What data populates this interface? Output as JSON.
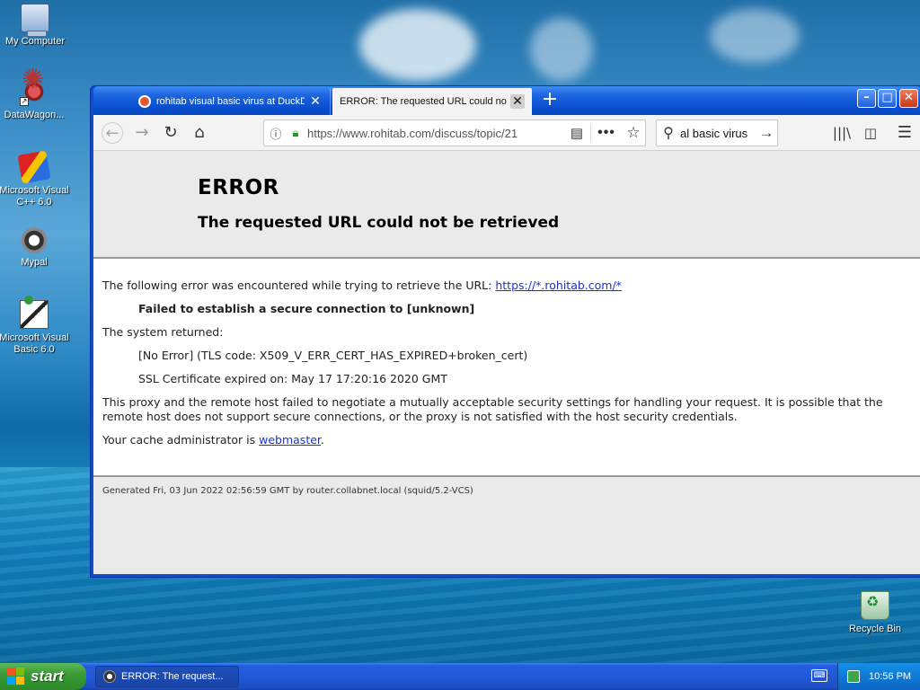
{
  "desktop": {
    "icons": [
      {
        "label": "My Computer",
        "icon": "computer-icon"
      },
      {
        "label": "DataWagon...",
        "icon": "datawagon-icon"
      },
      {
        "label": "Microsoft Visual C++ 6.0",
        "icon": "visual-cpp-icon"
      },
      {
        "label": "Mypal",
        "icon": "mypal-icon"
      },
      {
        "label": "Microsoft Visual Basic 6.0",
        "icon": "visual-basic-icon"
      },
      {
        "label": "Recycle Bin",
        "icon": "recycle-bin-icon"
      }
    ]
  },
  "browser": {
    "tabs": [
      {
        "label": "rohitab visual basic virus at DuckD",
        "active": false
      },
      {
        "label": "ERROR: The requested URL could not b",
        "active": true
      }
    ],
    "url": "https://www.rohitab.com/discuss/topic/21",
    "search_value": "al basic virus",
    "window_buttons": {
      "minimize": "–",
      "maximize": "□",
      "close": "✕"
    }
  },
  "page": {
    "title": "ERROR",
    "subtitle": "The requested URL could not be retrieved",
    "intro": "The following error was encountered while trying to retrieve the URL:",
    "intro_link": "https://*.rohitab.com/*",
    "failure": "Failed to establish a secure connection to [unknown]",
    "system_returned": "The system returned:",
    "tls_error": "[No Error] (TLS code: X509_V_ERR_CERT_HAS_EXPIRED+broken_cert)",
    "cert_expired": "SSL Certificate expired on: May 17 17:20:16 2020 GMT",
    "explanation": "This proxy and the remote host failed to negotiate a mutually acceptable security settings for handling your request. It is possible that the remote host does not support secure connections, or the proxy is not satisfied with the host security credentials.",
    "admin_prefix": "Your cache administrator is ",
    "admin_link": "webmaster",
    "admin_suffix": ".",
    "footer": "Generated Fri, 03 Jun 2022 02:56:59 GMT by router.collabnet.local (squid/5.2-VCS)"
  },
  "taskbar": {
    "start_label": "start",
    "task_label": "ERROR: The request...",
    "clock": "10:56 PM"
  },
  "colors": {
    "xp_blue": "#0a50d0",
    "start_green": "#3a9a36",
    "link": "#1a33cc",
    "lock_green": "#1d9a2a"
  }
}
